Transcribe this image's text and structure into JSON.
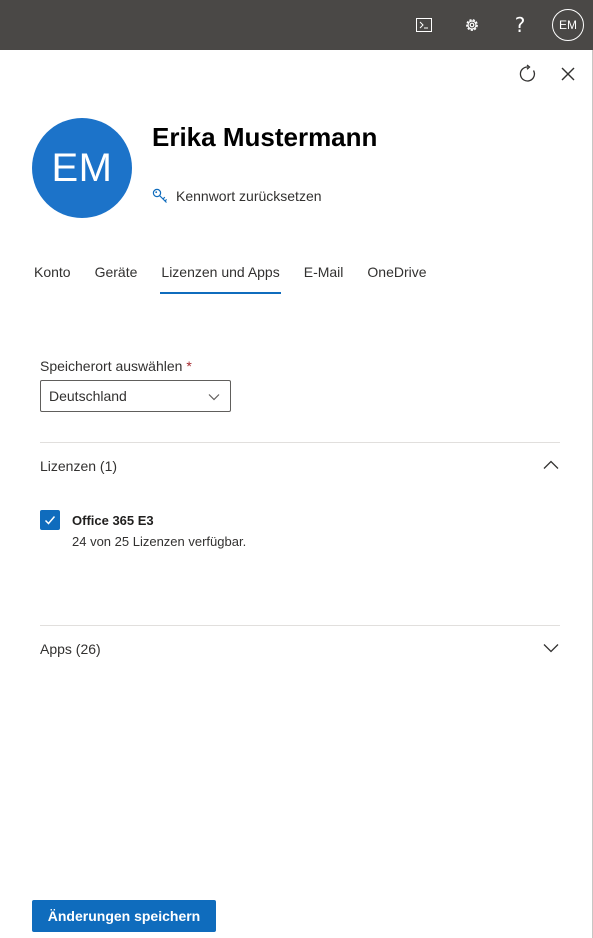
{
  "topbar": {
    "avatar_initials": "EM",
    "help_glyph": "?",
    "icons": [
      "terminal-icon",
      "gear-icon",
      "help-icon"
    ]
  },
  "panel": {
    "icons": [
      "refresh-icon",
      "close-icon"
    ]
  },
  "user": {
    "initials": "EM",
    "name": "Erika Mustermann",
    "reset_password": "Kennwort zurücksetzen",
    "avatar_color": "#1c73c9"
  },
  "tabs": [
    {
      "label": "Konto"
    },
    {
      "label": "Geräte"
    },
    {
      "label": "Lizenzen und Apps",
      "active": true
    },
    {
      "label": "E-Mail"
    },
    {
      "label": "OneDrive"
    }
  ],
  "location": {
    "label": "Speicherort auswählen",
    "required_marker": "*",
    "value": "Deutschland"
  },
  "licenses": {
    "title": "Lizenzen (1)",
    "expanded": true,
    "items": [
      {
        "name": "Office 365 E3",
        "availability": "24 von 25 Lizenzen verfügbar.",
        "checked": true
      }
    ]
  },
  "apps": {
    "title": "Apps (26)",
    "expanded": false
  },
  "actions": {
    "save_label": "Änderungen speichern"
  },
  "colors": {
    "accent": "#0f6cbd",
    "topbar": "#4a4846"
  }
}
